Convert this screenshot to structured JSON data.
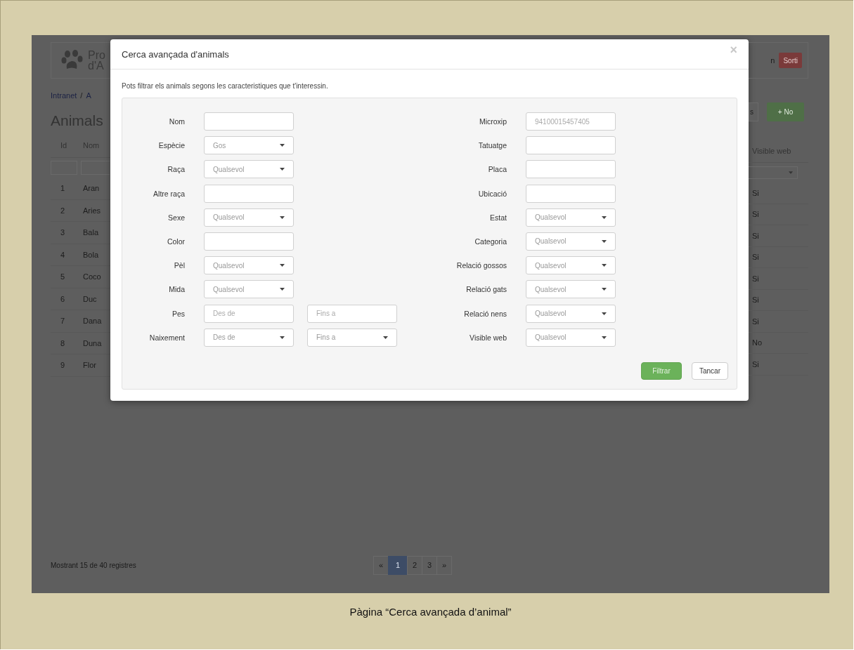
{
  "background_page": {
    "brand": [
      "Pro",
      "d'A"
    ],
    "breadcrumb": {
      "items": [
        "Intranet",
        "A"
      ],
      "separator": "/"
    },
    "heading": "Animals",
    "user_text": "n",
    "logout_button": "Sorti",
    "toolbar_buttons": [
      {
        "label": "s",
        "kind": "default"
      },
      {
        "label": "+ No",
        "kind": "success"
      }
    ],
    "table": {
      "columns": [
        "Id",
        "Nom"
      ],
      "last_column": "Visible web",
      "rows": [
        {
          "id": "1",
          "name": "Aran",
          "visible": "Si"
        },
        {
          "id": "2",
          "name": "Aries",
          "visible": "Si"
        },
        {
          "id": "3",
          "name": "Bala",
          "visible": "Si"
        },
        {
          "id": "4",
          "name": "Bola",
          "visible": "Si"
        },
        {
          "id": "5",
          "name": "Coco",
          "visible": "Si"
        },
        {
          "id": "6",
          "name": "Duc",
          "visible": "Si"
        },
        {
          "id": "7",
          "name": "Dana",
          "visible": "Si"
        },
        {
          "id": "8",
          "name": "Duna",
          "visible": "No"
        },
        {
          "id": "9",
          "name": "Flor",
          "visible": "Si"
        }
      ]
    },
    "footer": {
      "summary": "Mostrant 15 de 40 registres",
      "pagination": [
        {
          "label": "«",
          "selected": false
        },
        {
          "label": "1",
          "selected": true
        },
        {
          "label": "2",
          "selected": false
        },
        {
          "label": "3",
          "selected": false
        },
        {
          "label": "»",
          "selected": false
        }
      ]
    }
  },
  "modal": {
    "title": "Cerca avançada d'animals",
    "close": "×",
    "description": "Pots filtrar els animals segons les caracteristiques que t'interessin.",
    "left_fields": [
      {
        "label": "Nom",
        "inputs": [
          {
            "kind": "text"
          }
        ]
      },
      {
        "label": "Espècie",
        "inputs": [
          {
            "kind": "select",
            "value": "Gos"
          }
        ]
      },
      {
        "label": "Raça",
        "inputs": [
          {
            "kind": "select",
            "value": "Qualsevol"
          }
        ]
      },
      {
        "label": "Altre raça",
        "inputs": [
          {
            "kind": "text"
          }
        ]
      },
      {
        "label": "Sexe",
        "inputs": [
          {
            "kind": "select",
            "value": "Qualsevol"
          }
        ]
      },
      {
        "label": "Color",
        "inputs": [
          {
            "kind": "text"
          }
        ]
      },
      {
        "label": "Pèl",
        "inputs": [
          {
            "kind": "select",
            "value": "Qualsevol"
          }
        ]
      },
      {
        "label": "Mida",
        "inputs": [
          {
            "kind": "select",
            "value": "Qualsevol"
          }
        ]
      },
      {
        "label": "Pes",
        "inputs": [
          {
            "kind": "text",
            "placeholder": "Des de"
          },
          {
            "kind": "text",
            "placeholder": "Fins a"
          }
        ]
      },
      {
        "label": "Naixement",
        "inputs": [
          {
            "kind": "select",
            "value": "Des de"
          },
          {
            "kind": "select",
            "value": "Fins a"
          }
        ]
      }
    ],
    "right_fields": [
      {
        "label": "Microxip",
        "inputs": [
          {
            "kind": "text",
            "placeholder": "94100015457405"
          }
        ]
      },
      {
        "label": "Tatuatge",
        "inputs": [
          {
            "kind": "text"
          }
        ]
      },
      {
        "label": "Placa",
        "inputs": [
          {
            "kind": "text"
          }
        ]
      },
      {
        "label": "Ubicació",
        "inputs": [
          {
            "kind": "text"
          }
        ]
      },
      {
        "label": "Estat",
        "inputs": [
          {
            "kind": "select",
            "value": "Qualsevol"
          }
        ]
      },
      {
        "label": "Categoria",
        "inputs": [
          {
            "kind": "select",
            "value": "Qualsevol"
          }
        ]
      },
      {
        "label": "Relació gossos",
        "inputs": [
          {
            "kind": "select",
            "value": "Qualsevol"
          }
        ]
      },
      {
        "label": "Relació gats",
        "inputs": [
          {
            "kind": "select",
            "value": "Qualsevol"
          }
        ]
      },
      {
        "label": "Relació nens",
        "inputs": [
          {
            "kind": "select",
            "value": "Qualsevol"
          }
        ]
      },
      {
        "label": "Visible web",
        "inputs": [
          {
            "kind": "select",
            "value": "Qualsevol"
          }
        ]
      }
    ],
    "buttons": [
      {
        "label": "Filtrar",
        "kind": "primary"
      },
      {
        "label": "Tancar",
        "kind": "default"
      }
    ]
  },
  "caption": "Pàgina “Cerca avançada d’animal”"
}
